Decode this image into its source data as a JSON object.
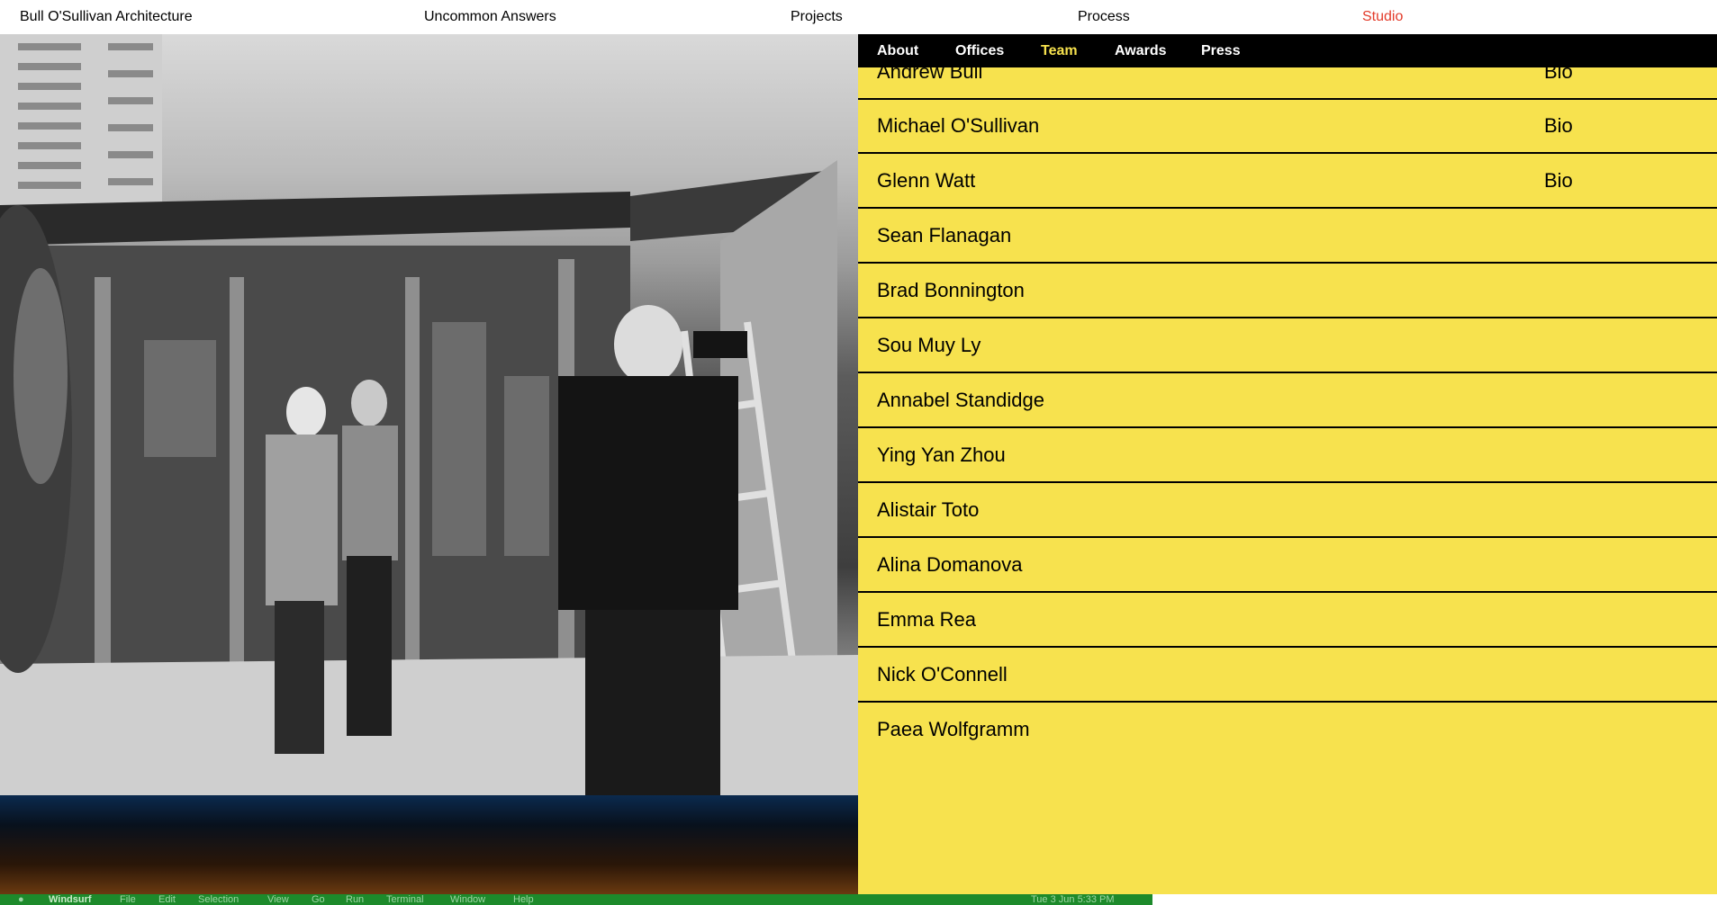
{
  "site": {
    "brand": "Bull O'Sullivan Architecture",
    "nav": [
      "Uncommon Answers",
      "Projects",
      "Process",
      "Studio"
    ],
    "active_nav": "Studio"
  },
  "subnav": {
    "items": [
      "About",
      "Offices",
      "Team",
      "Awards",
      "Press"
    ],
    "active": "Team"
  },
  "team": [
    {
      "name": "Andrew Bull",
      "bio": "Bio"
    },
    {
      "name": "Michael O'Sullivan",
      "bio": "Bio"
    },
    {
      "name": "Glenn Watt",
      "bio": "Bio"
    },
    {
      "name": "Sean Flanagan",
      "bio": ""
    },
    {
      "name": "Brad Bonnington",
      "bio": ""
    },
    {
      "name": "Sou Muy Ly",
      "bio": ""
    },
    {
      "name": "Annabel Standidge",
      "bio": ""
    },
    {
      "name": "Ying Yan Zhou",
      "bio": ""
    },
    {
      "name": "Alistair Toto",
      "bio": ""
    },
    {
      "name": "Alina Domanova",
      "bio": ""
    },
    {
      "name": "Emma Rea",
      "bio": ""
    },
    {
      "name": "Nick O'Connell",
      "bio": ""
    },
    {
      "name": "Paea Wolfgramm",
      "bio": ""
    }
  ],
  "menubar": {
    "app": "Windsurf",
    "items": [
      "File",
      "Edit",
      "Selection",
      "View",
      "Go",
      "Run",
      "Terminal",
      "Window",
      "Help"
    ],
    "clock": "Tue 3 Jun 5:33 PM"
  },
  "colors": {
    "panel": "#f7e24e",
    "active_nav": "#e33b2a",
    "subnav_bg": "#000000"
  }
}
